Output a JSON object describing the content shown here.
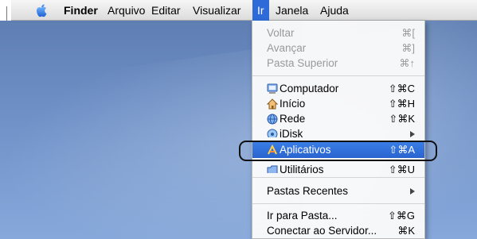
{
  "menubar": {
    "apple_icon": "apple-icon",
    "items": [
      "Finder",
      "Arquivo",
      "Editar",
      "Visualizar",
      "Ir",
      "Janela",
      "Ajuda"
    ],
    "active_item": "Ir",
    "active_color": "#2f6bd8"
  },
  "go_menu": {
    "navigation": [
      {
        "label": "Voltar",
        "shortcut": "⌘[",
        "enabled": false
      },
      {
        "label": "Avançar",
        "shortcut": "⌘]",
        "enabled": false
      },
      {
        "label": "Pasta Superior",
        "shortcut": "⌘↑",
        "enabled": false
      }
    ],
    "locations": [
      {
        "label": "Computador",
        "shortcut": "⇧⌘C",
        "icon": "computer-icon"
      },
      {
        "label": "Início",
        "shortcut": "⇧⌘H",
        "icon": "home-icon"
      },
      {
        "label": "Rede",
        "shortcut": "⇧⌘K",
        "icon": "network-icon"
      },
      {
        "label": "iDisk",
        "shortcut": "",
        "icon": "idisk-icon",
        "submenu": true
      },
      {
        "label": "Aplicativos",
        "shortcut": "⇧⌘A",
        "icon": "applications-icon",
        "highlighted": true
      },
      {
        "label": "Utilitários",
        "shortcut": "⇧⌘U",
        "icon": "utilities-icon"
      }
    ],
    "recent": {
      "label": "Pastas Recentes",
      "submenu": true
    },
    "folder_actions": [
      {
        "label": "Ir para Pasta...",
        "shortcut": "⇧⌘G"
      },
      {
        "label": "Conectar ao Servidor...",
        "shortcut": "⌘K"
      }
    ],
    "highlight_color": "#2a63cf"
  }
}
